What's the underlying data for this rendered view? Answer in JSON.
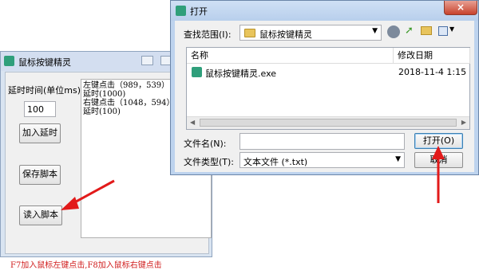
{
  "main": {
    "title": "鼠标按键精灵",
    "delay_label": "延时时间(单位ms)",
    "delay_value": "100",
    "add_delay_button": "加入延时",
    "save_script_button": "保存脚本",
    "read_script_button": "读入脚本",
    "log_lines": "左键点击（989，539）\n延时(1000)\n右键点击（1048，594）\n延时(100)",
    "hint": "F7加入鼠标左键点击,F8加入鼠标右键点击"
  },
  "dialog": {
    "title": "打开",
    "close_glyph": "×",
    "look_in_label": "查找范围(I):",
    "look_in_value": "鼠标按键精灵",
    "columns": {
      "name": "名称",
      "modified": "修改日期"
    },
    "files": [
      {
        "name": "鼠标按键精灵.exe",
        "modified": "2018-11-4 1:15"
      }
    ],
    "filename_label": "文件名(N):",
    "filename_value": "",
    "filetype_label": "文件类型(T):",
    "filetype_value": "文本文件 (*.txt)",
    "open_button": "打开(O)",
    "cancel_button": "取消"
  },
  "colors": {
    "arrow": "#e21a1a",
    "hint": "#d01c1c",
    "titlebar": "#c9daf0"
  }
}
